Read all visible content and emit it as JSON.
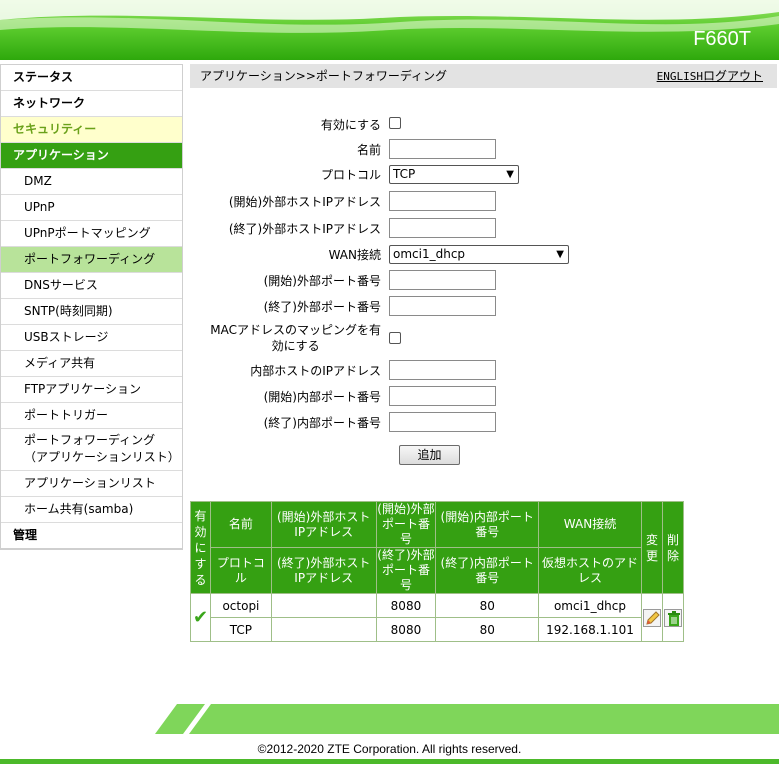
{
  "header": {
    "model": "F660T"
  },
  "sidebar": {
    "status": "ステータス",
    "network": "ネットワーク",
    "security": "セキュリティー",
    "application": "アプリケーション",
    "sub_items": [
      "DMZ",
      "UPnP",
      "UPnPポートマッピング",
      "ポートフォワーディング",
      "DNSサービス",
      "SNTP(時刻同期)",
      "USBストレージ",
      "メディア共有",
      "FTPアプリケーション",
      "ポートトリガー",
      "ポートフォワーディング（アプリケーションリスト）",
      "アプリケーションリスト",
      "ホーム共有(samba)"
    ],
    "admin": "管理"
  },
  "content": {
    "breadcrumb": "アプリケーション>>ポートフォワーディング",
    "english_link": "ENGLISH",
    "logout_link": "ログアウト"
  },
  "form": {
    "enable_label": "有効にする",
    "name_label": "名前",
    "protocol_label": "プロトコル",
    "protocol_value": "TCP",
    "ext_host_start_label": "(開始)外部ホストIPアドレス",
    "ext_host_end_label": "(終了)外部ホストIPアドレス",
    "wan_label": "WAN接続",
    "wan_value": "omci1_dhcp",
    "ext_port_start_label": "(開始)外部ポート番号",
    "ext_port_end_label": "(終了)外部ポート番号",
    "mac_mapping_label_1": "MACアドレスのマッピングを有",
    "mac_mapping_label_2": "効にする",
    "int_host_label": "内部ホストのIPアドレス",
    "int_port_start_label": "(開始)内部ポート番号",
    "int_port_end_label": "(終了)内部ポート番号",
    "add_button": "追加"
  },
  "table": {
    "h_enable": "有効にする",
    "h_name": "名前",
    "h_ext_host_start": "(開始)外部ホストIPアドレス",
    "h_ext_port_start": "(開始)外部ポート番号",
    "h_int_port_start": "(開始)内部ポート番号",
    "h_wan": "WAN接続",
    "h_modify": "変更",
    "h_delete": "削除",
    "h_protocol": "プロトコル",
    "h_ext_host_end": "(終了)外部ホストIPアドレス",
    "h_ext_port_end": "(終了)外部ポート番号",
    "h_int_port_end": "(終了)内部ポート番号",
    "h_virtual_host": "仮想ホストのアドレス",
    "rows": [
      {
        "enabled_mark": "✔",
        "name": "octopi",
        "ext_host_start": "",
        "ext_port_start": "8080",
        "int_port_start": "80",
        "wan": "omci1_dhcp",
        "protocol": "TCP",
        "ext_host_end": "",
        "ext_port_end": "8080",
        "int_port_end": "80",
        "virtual_host": "192.168.1.101"
      }
    ]
  },
  "footer": {
    "copyright": "©2012-2020 ZTE Corporation. All rights reserved."
  },
  "colors": {
    "brand_green": "#35a012",
    "highlight": "#b8e39a",
    "security_bg": "#ffffcc"
  }
}
